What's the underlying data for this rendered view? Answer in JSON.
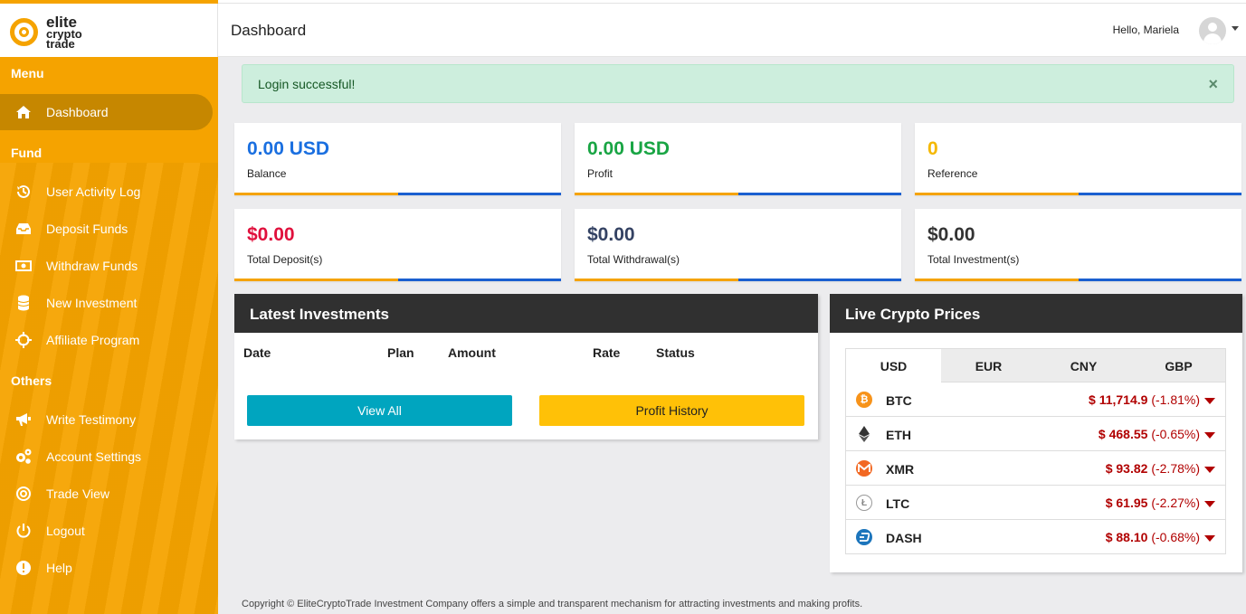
{
  "logo": {
    "line1": "elite",
    "line2": "crypto",
    "line3": "trade"
  },
  "header": {
    "title": "Dashboard",
    "greeting": "Hello, Mariela"
  },
  "sidebar": {
    "sections": {
      "menu": "Menu",
      "fund": "Fund",
      "others": "Others"
    },
    "items": [
      {
        "label": "Dashboard",
        "icon": "home-icon"
      },
      {
        "label": "User Activity Log",
        "icon": "history-icon"
      },
      {
        "label": "Deposit Funds",
        "icon": "inbox-icon"
      },
      {
        "label": "Withdraw Funds",
        "icon": "money-bill-icon"
      },
      {
        "label": "New Investment",
        "icon": "database-icon"
      },
      {
        "label": "Affiliate Program",
        "icon": "crosshairs-icon"
      },
      {
        "label": "Write Testimony",
        "icon": "bullhorn-icon"
      },
      {
        "label": "Account Settings",
        "icon": "cogs-icon"
      },
      {
        "label": "Trade View",
        "icon": "target-icon"
      },
      {
        "label": "Logout",
        "icon": "power-icon"
      },
      {
        "label": "Help",
        "icon": "info-circle-icon"
      }
    ]
  },
  "alert": {
    "message": "Login successful!",
    "close": "×"
  },
  "stats": [
    {
      "value": "0.00 USD",
      "label": "Balance",
      "color": "#1a6fe0"
    },
    {
      "value": "0.00 USD",
      "label": "Profit",
      "color": "#19a544"
    },
    {
      "value": "0",
      "label": "Reference",
      "color": "#f5b800"
    },
    {
      "value": "$0.00",
      "label": "Total Deposit(s)",
      "color": "#e0103c"
    },
    {
      "value": "$0.00",
      "label": "Total Withdrawal(s)",
      "color": "#344263"
    },
    {
      "value": "$0.00",
      "label": "Total Investment(s)",
      "color": "#333333"
    }
  ],
  "investments": {
    "title": "Latest Investments",
    "columns": [
      "Date",
      "Plan",
      "Amount",
      "Rate",
      "Status"
    ],
    "view_all": "View All",
    "profit_history": "Profit History"
  },
  "crypto": {
    "title": "Live Crypto Prices",
    "tabs": [
      "USD",
      "EUR",
      "CNY",
      "GBP"
    ],
    "rows": [
      {
        "symbol": "BTC",
        "price": "$ 11,714.9",
        "change": "(-1.81%)",
        "icon": "bitcoin-icon"
      },
      {
        "symbol": "ETH",
        "price": "$ 468.55",
        "change": "(-0.65%)",
        "icon": "ethereum-icon"
      },
      {
        "symbol": "XMR",
        "price": "$ 93.82",
        "change": "(-2.78%)",
        "icon": "monero-icon"
      },
      {
        "symbol": "LTC",
        "price": "$ 61.95",
        "change": "(-2.27%)",
        "icon": "litecoin-icon"
      },
      {
        "symbol": "DASH",
        "price": "$ 88.10",
        "change": "(-0.68%)",
        "icon": "dash-icon"
      }
    ]
  },
  "footer": {
    "text": "Copyright © EliteCryptoTrade Investment Company offers a simple and transparent mechanism for attracting investments and making profits."
  }
}
